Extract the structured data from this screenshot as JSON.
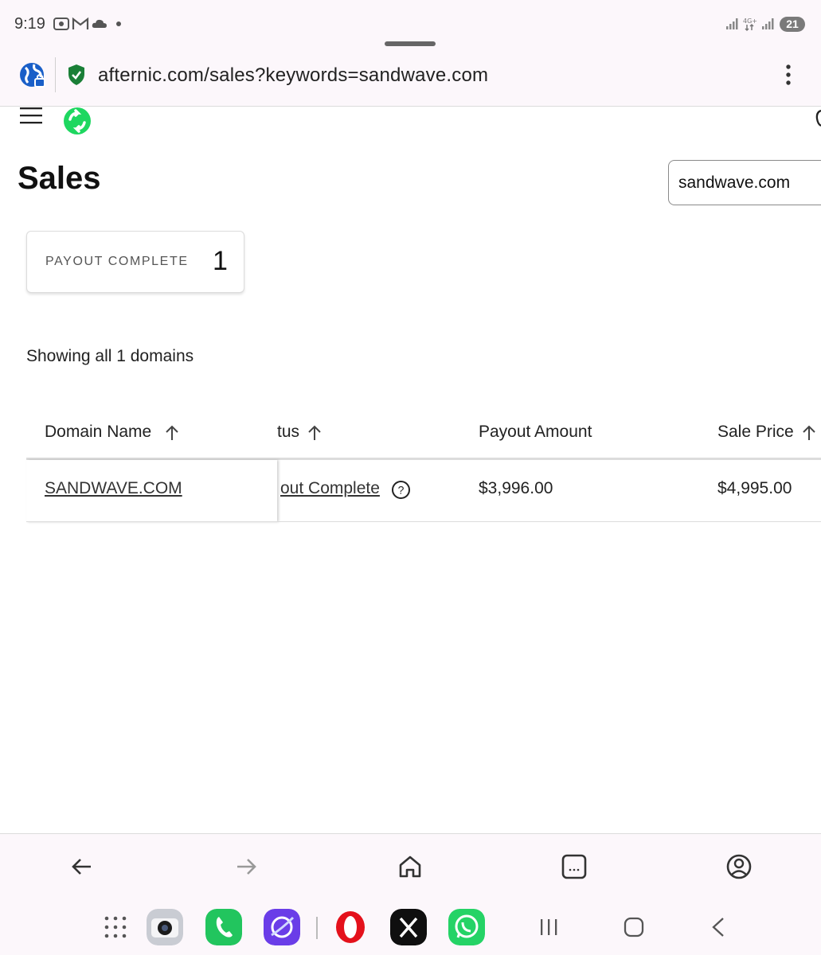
{
  "status_bar": {
    "time": "9:19",
    "battery": "21"
  },
  "address_bar": {
    "url": "afternic.com/sales?keywords=sandwave.com"
  },
  "page": {
    "title": "Sales",
    "search_value": "sandwave.com",
    "summary": {
      "label": "PAYOUT COMPLETE",
      "count": "1"
    },
    "showing": "Showing all 1 domains"
  },
  "table": {
    "headers": {
      "domain": "Domain Name",
      "status": "tus",
      "payout": "Payout Amount",
      "price": "Sale Price"
    },
    "rows": [
      {
        "domain": "SANDWAVE.COM",
        "status": "out Complete",
        "payout": "$3,996.00",
        "price": "$4,995.00"
      }
    ]
  },
  "colors": {
    "chrome_bg": "#fcf7fb",
    "secure_green": "#1a7f37",
    "brand_green": "#1ed760"
  },
  "icons": {
    "status_bar": [
      "photo-icon",
      "gmail-icon",
      "cloud-icon",
      "dot-icon",
      "signal-icon",
      "4g-icon",
      "signal-icon"
    ],
    "bottom_nav": [
      "back-arrow-icon",
      "forward-arrow-icon",
      "home-icon",
      "tabs-icon",
      "account-icon"
    ],
    "dock": [
      "apps-grid-icon",
      "camera-app-icon",
      "phone-app-icon",
      "internet-app-icon",
      "opera-app-icon",
      "x-app-icon",
      "whatsapp-app-icon",
      "recents-icon",
      "home-circle-icon",
      "back-chevron-icon"
    ]
  }
}
